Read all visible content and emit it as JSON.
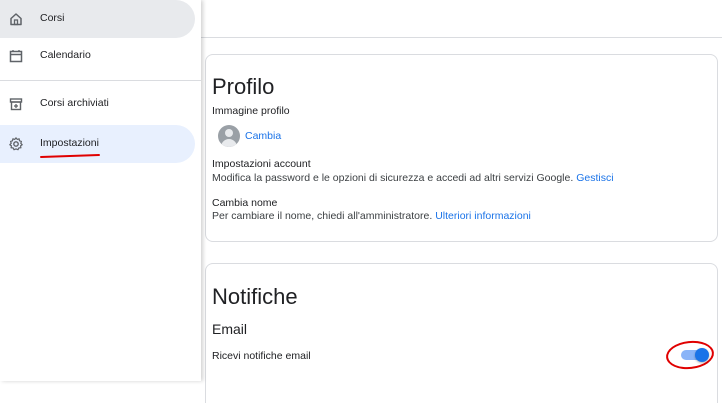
{
  "sidebar": {
    "items": [
      {
        "label": "Corsi",
        "icon": "home-icon"
      },
      {
        "label": "Calendario",
        "icon": "calendar-icon"
      },
      {
        "label": "Corsi archiviati",
        "icon": "archive-icon"
      },
      {
        "label": "Impostazioni",
        "icon": "settings-icon"
      }
    ],
    "selected": "Impostazioni"
  },
  "profile": {
    "title": "Profilo",
    "image_label": "Immagine profilo",
    "change_link": "Cambia",
    "account_label": "Impostazioni account",
    "account_text": "Modifica la password e le opzioni di sicurezza e accedi ad altri servizi Google.",
    "account_link": "Gestisci",
    "name_label": "Cambia nome",
    "name_text": "Per cambiare il nome, chiedi all'amministratore.",
    "name_link": "Ulteriori informazioni"
  },
  "notifications": {
    "title": "Notifiche",
    "email_heading": "Email",
    "receive_label": "Ricevi notifiche email",
    "receive_enabled": true
  },
  "colors": {
    "accent": "#1a73e8",
    "selected_bg": "#e8f0fe",
    "annotation": "#e00000"
  }
}
